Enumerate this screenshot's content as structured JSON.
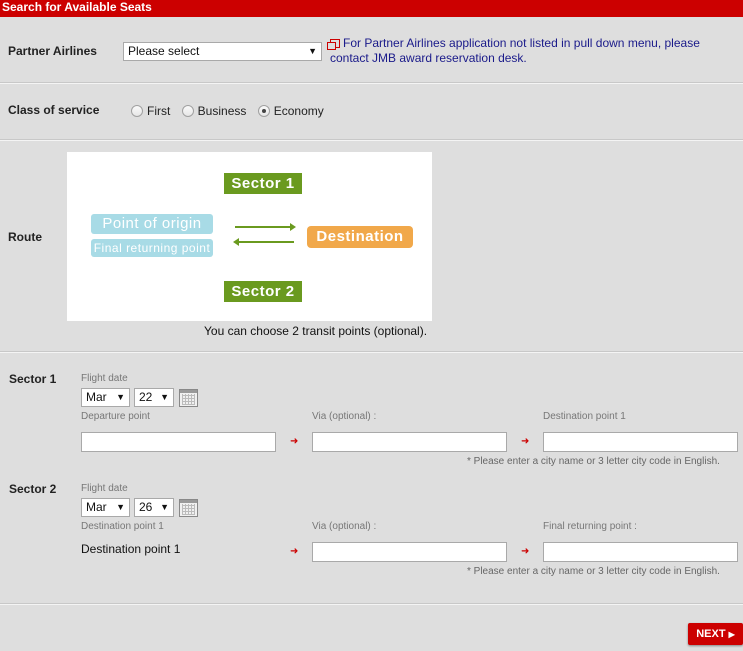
{
  "header": {
    "title": "Search for Available Seats"
  },
  "partner": {
    "label": "Partner Airlines",
    "select_value": "Please select",
    "notice": "For Partner Airlines application not listed in pull down menu, please contact JMB award reservation desk."
  },
  "class_of_service": {
    "label": "Class of service",
    "options": [
      "First",
      "Business",
      "Economy"
    ],
    "selected": "Economy"
  },
  "route": {
    "label": "Route",
    "sector1_tag": "Sector 1",
    "sector2_tag": "Sector 2",
    "origin": "Point of origin",
    "final_return": "Final returning point",
    "destination": "Destination",
    "transit_note": "You can choose 2 transit points (optional)."
  },
  "sector1": {
    "label": "Sector 1",
    "flight_date_label": "Flight date",
    "month": "Mar",
    "day": "22",
    "departure_label": "Departure point",
    "via_label": "Via (optional) :",
    "destination_label": "Destination point 1",
    "departure_value": "",
    "via_value": "",
    "destination_value": "",
    "hint": "* Please enter a city name or 3 letter city code in English."
  },
  "sector2": {
    "label": "Sector 2",
    "flight_date_label": "Flight date",
    "month": "Mar",
    "day": "26",
    "origin_label": "Destination point 1",
    "origin_value": "Destination point 1",
    "via_label": "Via (optional) :",
    "final_label": "Final returning point :",
    "via_value": "",
    "final_value": "",
    "hint": "* Please enter a city name or 3 letter city code in English."
  },
  "footer": {
    "next_label": "NEXT"
  },
  "colors": {
    "brand_red": "#cc0000",
    "sector_green": "#6a9a1f",
    "origin_blue": "#a8dbe6",
    "destination_orange": "#f1a84a"
  }
}
